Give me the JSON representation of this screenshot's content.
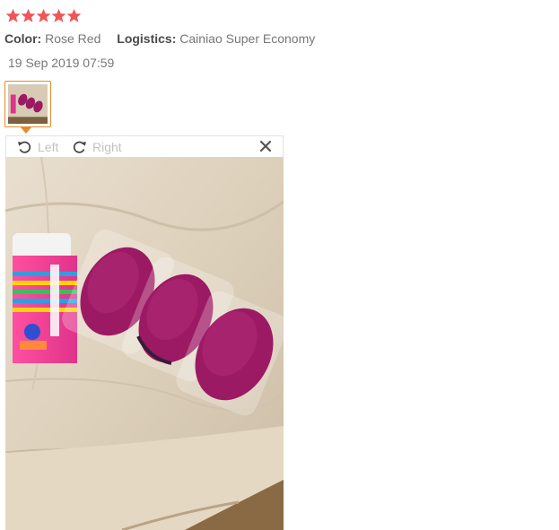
{
  "review": {
    "rating": 5,
    "color_label": "Color:",
    "color_value": "Rose Red",
    "logistics_label": "Logistics:",
    "logistics_value": "Cainiao Super Economy",
    "date": "19 Sep 2019 07:59"
  },
  "viewer": {
    "rotate_left_label": "Left",
    "rotate_right_label": "Right"
  },
  "colors": {
    "star": "#f0555a",
    "thumb_border": "#e58b28",
    "insole": "#9c1a63"
  },
  "icons": {
    "rating": "star-icon",
    "rotate_left": "rotate-left-icon",
    "rotate_right": "rotate-right-icon",
    "close": "close-icon"
  }
}
